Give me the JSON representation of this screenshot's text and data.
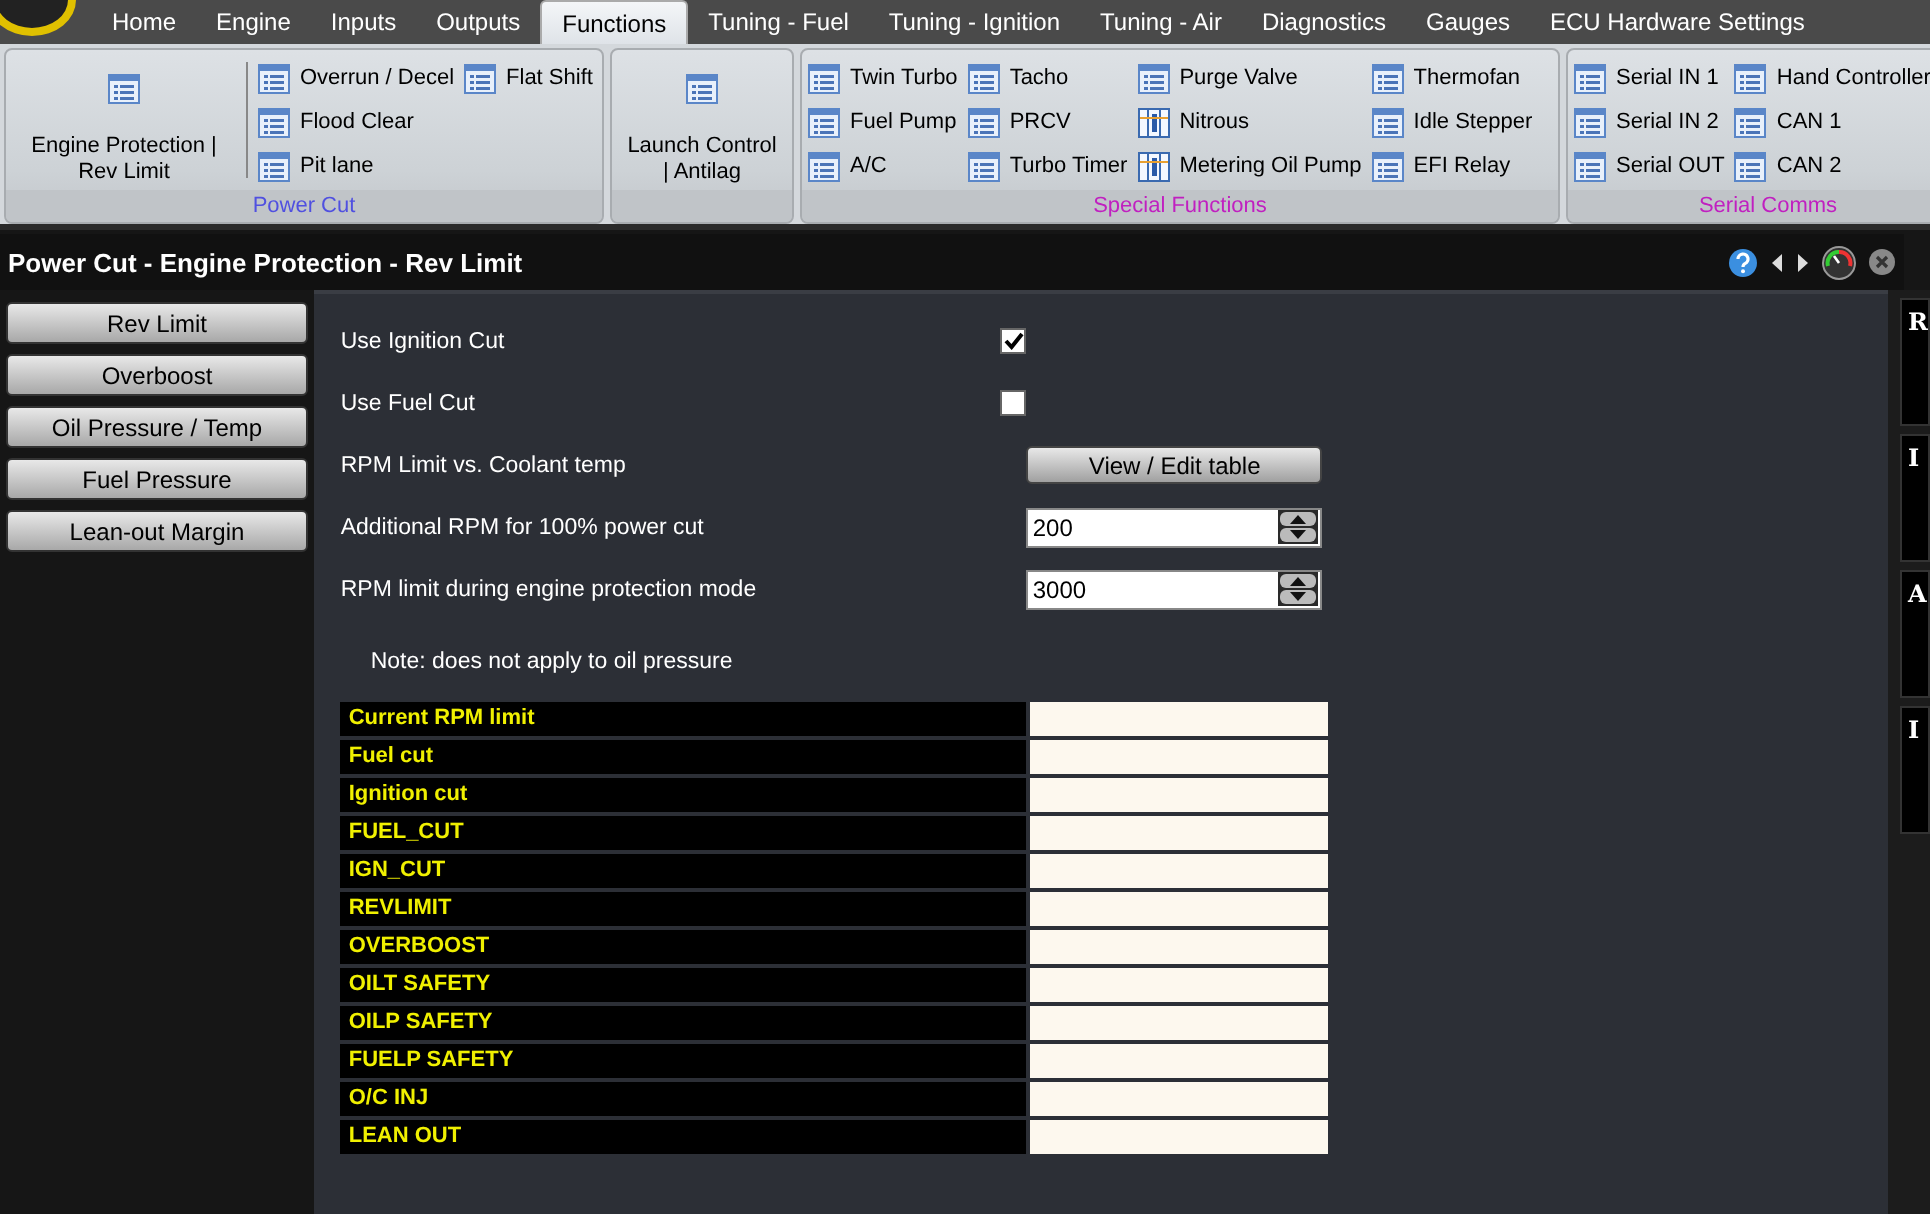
{
  "tabs": [
    {
      "label": "Home",
      "selected": false
    },
    {
      "label": "Engine",
      "selected": false
    },
    {
      "label": "Inputs",
      "selected": false
    },
    {
      "label": "Outputs",
      "selected": false
    },
    {
      "label": "Functions",
      "selected": true
    },
    {
      "label": "Tuning - Fuel",
      "selected": false
    },
    {
      "label": "Tuning - Ignition",
      "selected": false
    },
    {
      "label": "Tuning - Air",
      "selected": false
    },
    {
      "label": "Diagnostics",
      "selected": false
    },
    {
      "label": "Gauges",
      "selected": false
    },
    {
      "label": "ECU Hardware Settings",
      "selected": false
    }
  ],
  "ribbon": {
    "groups": [
      {
        "label": "Power Cut",
        "color": "#5050e0",
        "large": {
          "label": "Engine Protection | Rev Limit"
        },
        "columns": [
          [
            {
              "label": "Overrun / Decel",
              "kind": "list"
            },
            {
              "label": "Flood Clear",
              "kind": "list"
            },
            {
              "label": "Pit lane",
              "kind": "list"
            }
          ],
          [
            {
              "label": "Flat Shift",
              "kind": "list"
            }
          ]
        ]
      },
      {
        "large": {
          "label": "Launch Control | Antilag"
        }
      },
      {
        "label": "Special Functions",
        "color": "#c020c0",
        "columns": [
          [
            {
              "label": "Twin Turbo",
              "kind": "list"
            },
            {
              "label": "Fuel Pump",
              "kind": "list"
            },
            {
              "label": "A/C",
              "kind": "list"
            }
          ],
          [
            {
              "label": "Tacho",
              "kind": "list"
            },
            {
              "label": "PRCV",
              "kind": "list"
            },
            {
              "label": "Turbo Timer",
              "kind": "list"
            }
          ],
          [
            {
              "label": "Purge Valve",
              "kind": "list"
            },
            {
              "label": "Nitrous",
              "kind": "table"
            },
            {
              "label": "Metering Oil Pump",
              "kind": "table"
            }
          ],
          [
            {
              "label": "Thermofan",
              "kind": "list"
            },
            {
              "label": "Idle Stepper",
              "kind": "list"
            },
            {
              "label": "EFI Relay",
              "kind": "list"
            }
          ]
        ]
      },
      {
        "label": "Serial Comms",
        "color": "#c020c0",
        "columns": [
          [
            {
              "label": "Serial IN 1",
              "kind": "list"
            },
            {
              "label": "Serial IN 2",
              "kind": "list"
            },
            {
              "label": "Serial OUT",
              "kind": "list"
            }
          ],
          [
            {
              "label": "Hand Controller",
              "kind": "list"
            },
            {
              "label": "CAN 1",
              "kind": "list"
            },
            {
              "label": "CAN 2",
              "kind": "list"
            }
          ]
        ]
      }
    ]
  },
  "window": {
    "title": "Power Cut - Engine Protection - Rev Limit"
  },
  "sidebar": {
    "items": [
      "Rev Limit",
      "Overboost",
      "Oil Pressure / Temp",
      "Fuel Pressure",
      "Lean-out Margin"
    ]
  },
  "form": {
    "rows": [
      {
        "kind": "checkbox",
        "label": "Use Ignition Cut",
        "checked": true
      },
      {
        "kind": "checkbox",
        "label": "Use Fuel Cut",
        "checked": false
      },
      {
        "kind": "button",
        "label": "RPM Limit vs. Coolant temp",
        "button": "View / Edit table"
      },
      {
        "kind": "spin",
        "label": "Additional RPM for 100% power cut",
        "value": "200"
      },
      {
        "kind": "spin",
        "label": "RPM limit during engine protection mode",
        "value": "3000"
      }
    ],
    "note": "Note: does not apply to oil pressure"
  },
  "status_table": {
    "rows": [
      {
        "label": "Current RPM limit"
      },
      {
        "label": "Fuel cut"
      },
      {
        "label": "Ignition cut"
      },
      {
        "label": "FUEL_CUT"
      },
      {
        "label": "IGN_CUT"
      },
      {
        "label": "REVLIMIT"
      },
      {
        "label": "OVERBOOST"
      },
      {
        "label": "OILT SAFETY"
      },
      {
        "label": "OILP SAFETY"
      },
      {
        "label": "FUELP SAFETY"
      },
      {
        "label": "O/C INJ"
      },
      {
        "label": "LEAN OUT"
      }
    ]
  },
  "side_panel": {
    "headings": [
      "R",
      "I",
      "A",
      "I"
    ]
  }
}
